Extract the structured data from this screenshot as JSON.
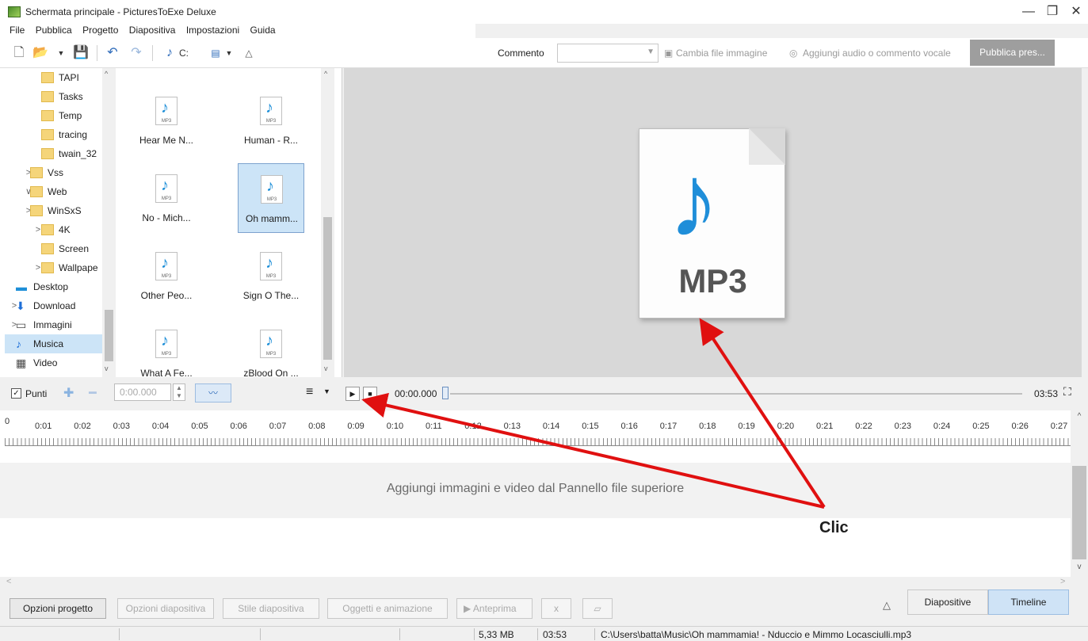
{
  "window": {
    "title": "Schermata principale - PicturesToExe Deluxe",
    "minimize": "—",
    "restore": "❐",
    "close": "✕"
  },
  "menu": [
    "File",
    "Pubblica",
    "Progetto",
    "Diapositiva",
    "Impostazioni",
    "Guida"
  ],
  "toolbar": {
    "drive_label": "C:",
    "comment_label": "Commento",
    "change_image_label": "Cambia file immagine",
    "add_audio_label": "Aggiungi audio o commento vocale",
    "publish_label": "Pubblica pres..."
  },
  "tree": [
    {
      "label": "TAPI",
      "expandable": false,
      "icon": "folder-icon"
    },
    {
      "label": "Tasks",
      "expandable": false,
      "icon": "folder-icon"
    },
    {
      "label": "Temp",
      "expandable": false,
      "icon": "folder-icon"
    },
    {
      "label": "tracing",
      "expandable": false,
      "icon": "folder-icon"
    },
    {
      "label": "twain_32",
      "expandable": false,
      "icon": "folder-icon"
    },
    {
      "label": "Vss",
      "expandable": true,
      "icon": "folder-icon"
    },
    {
      "label": "Web",
      "expandable": true,
      "expanded": true,
      "icon": "folder-icon"
    },
    {
      "label": "WinSxS",
      "expandable": true,
      "icon": "folder-icon"
    },
    {
      "label": "4K",
      "expandable": true,
      "icon": "folder-icon"
    },
    {
      "label": "Screen",
      "expandable": false,
      "icon": "folder-icon"
    },
    {
      "label": "Wallpape",
      "expandable": true,
      "icon": "folder-icon"
    },
    {
      "label": "Desktop",
      "expandable": false,
      "icon": "desktop-icon"
    },
    {
      "label": "Download",
      "expandable": true,
      "icon": "download-icon"
    },
    {
      "label": "Immagini",
      "expandable": true,
      "icon": "images-icon"
    },
    {
      "label": "Musica",
      "expandable": false,
      "icon": "music-icon",
      "selected": true
    },
    {
      "label": "Video",
      "expandable": false,
      "icon": "video-icon"
    }
  ],
  "files": [
    {
      "name": "Hear Me N...",
      "type": "MP3"
    },
    {
      "name": "Human - R...",
      "type": "MP3"
    },
    {
      "name": "No - Mich...",
      "type": "MP3"
    },
    {
      "name": "Oh mamm...",
      "type": "MP3",
      "selected": true
    },
    {
      "name": "Other Peo...",
      "type": "MP3"
    },
    {
      "name": "Sign O The...",
      "type": "MP3"
    },
    {
      "name": "What A Fe...",
      "type": "MP3"
    },
    {
      "name": "zBlood On ...",
      "type": "MP3"
    }
  ],
  "preview": {
    "label": "MP3"
  },
  "controls": {
    "points_label": "Punti",
    "points_checked": true,
    "time_value": "0:00.000",
    "position": "00:00.000",
    "duration": "03:53"
  },
  "ruler": [
    "0",
    "0:01",
    "0:02",
    "0:03",
    "0:04",
    "0:05",
    "0:06",
    "0:07",
    "0:08",
    "0:09",
    "0:10",
    "0:11",
    "0:12",
    "0:13",
    "0:14",
    "0:15",
    "0:16",
    "0:17",
    "0:18",
    "0:19",
    "0:20",
    "0:21",
    "0:22",
    "0:23",
    "0:24",
    "0:25",
    "0:26",
    "0:27"
  ],
  "timeline": {
    "hint": "Aggiungi immagini e video dal Pannello file superiore"
  },
  "bottom": {
    "project_options": "Opzioni progetto",
    "slide_options": "Opzioni diapositiva",
    "slide_style": "Stile diapositiva",
    "objects_animation": "Oggetti e animazione",
    "preview": "Anteprima",
    "x_label": "x",
    "tab_slides": "Diapositive",
    "tab_timeline": "Timeline"
  },
  "status": {
    "size": "5,33 MB",
    "duration": "03:53",
    "path": "C:\\Users\\batta\\Music\\Oh mammamia! - Nduccio e Mimmo Locasciulli.mp3"
  },
  "annotation": {
    "label": "Clic",
    "color": "#e01010"
  },
  "colors": {
    "accent": "#2f6cba",
    "selection": "#cce4f7",
    "note_blue": "#1f8ed9"
  }
}
